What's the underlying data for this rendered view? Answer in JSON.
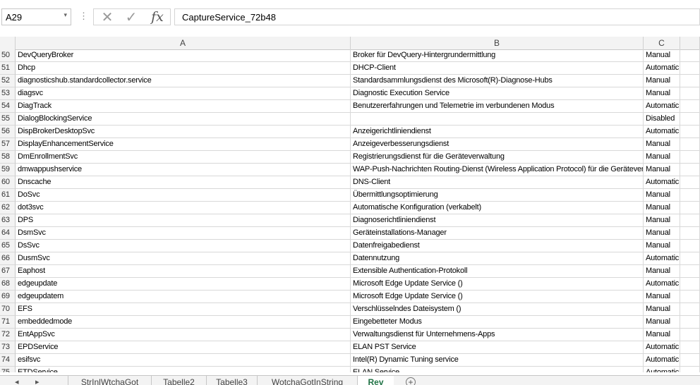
{
  "namebox": {
    "value": "A29",
    "arrow": "▾"
  },
  "formula_bar": {
    "value": "CaptureService_72b48",
    "dots": "⋮",
    "cancel": "✕",
    "enter": "✓",
    "fx": "fx"
  },
  "columns": [
    "A",
    "B",
    "C"
  ],
  "rows": [
    {
      "n": "50",
      "a": "DevQueryBroker",
      "b": "Broker für DevQuery-Hintergrundermittlung",
      "c": "Manual"
    },
    {
      "n": "51",
      "a": "Dhcp",
      "b": "DHCP-Client",
      "c": "Automatic"
    },
    {
      "n": "52",
      "a": "diagnosticshub.standardcollector.service",
      "b": "Standardsammlungsdienst des Microsoft(R)-Diagnose-Hubs",
      "c": "Manual"
    },
    {
      "n": "53",
      "a": "diagsvc",
      "b": "Diagnostic Execution Service",
      "c": "Manual"
    },
    {
      "n": "54",
      "a": "DiagTrack",
      "b": "Benutzererfahrungen und Telemetrie im verbundenen Modus",
      "c": "Automatic"
    },
    {
      "n": "55",
      "a": "DialogBlockingService",
      "b": "",
      "c": "Disabled"
    },
    {
      "n": "56",
      "a": "DispBrokerDesktopSvc",
      "b": "Anzeigerichtliniendienst",
      "c": "Automatic"
    },
    {
      "n": "57",
      "a": "DisplayEnhancementService",
      "b": "Anzeigeverbesserungsdienst",
      "c": "Manual"
    },
    {
      "n": "58",
      "a": "DmEnrollmentSvc",
      "b": "Registrierungsdienst für die Geräteverwaltung",
      "c": "Manual"
    },
    {
      "n": "59",
      "a": "dmwappushservice",
      "b": "WAP-Push-Nachrichten Routing-Dienst (Wireless Application Protocol) für die Geräteverwaltung",
      "c": "Manual"
    },
    {
      "n": "60",
      "a": "Dnscache",
      "b": "DNS-Client",
      "c": "Automatic"
    },
    {
      "n": "61",
      "a": "DoSvc",
      "b": "Übermittlungsoptimierung",
      "c": "Manual"
    },
    {
      "n": "62",
      "a": "dot3svc",
      "b": "Automatische Konfiguration (verkabelt)",
      "c": "Manual"
    },
    {
      "n": "63",
      "a": "DPS",
      "b": "Diagnoserichtliniendienst",
      "c": "Manual"
    },
    {
      "n": "64",
      "a": "DsmSvc",
      "b": "Geräteinstallations-Manager",
      "c": "Manual"
    },
    {
      "n": "65",
      "a": "DsSvc",
      "b": "Datenfreigabedienst",
      "c": "Manual"
    },
    {
      "n": "66",
      "a": "DusmSvc",
      "b": "Datennutzung",
      "c": "Automatic"
    },
    {
      "n": "67",
      "a": "Eaphost",
      "b": "Extensible Authentication-Protokoll",
      "c": "Manual"
    },
    {
      "n": "68",
      "a": "edgeupdate",
      "b": "Microsoft Edge Update Service ()",
      "c": "Automatic"
    },
    {
      "n": "69",
      "a": "edgeupdatem",
      "b": "Microsoft Edge Update Service ()",
      "c": "Manual"
    },
    {
      "n": "70",
      "a": "EFS",
      "b": "Verschlüsselndes Dateisystem ()",
      "c": "Manual"
    },
    {
      "n": "71",
      "a": "embeddedmode",
      "b": "Eingebetteter Modus",
      "c": "Manual"
    },
    {
      "n": "72",
      "a": "EntAppSvc",
      "b": "Verwaltungsdienst für Unternehmens-Apps",
      "c": "Manual"
    },
    {
      "n": "73",
      "a": "EPDService",
      "b": "ELAN PST Service",
      "c": "Automatic"
    },
    {
      "n": "74",
      "a": "esifsvc",
      "b": "Intel(R) Dynamic Tuning service",
      "c": "Automatic"
    },
    {
      "n": "75",
      "a": "ETDService",
      "b": "ELAN Service",
      "c": "Automatic"
    }
  ],
  "sheet_tabs": [
    {
      "label": "StrInlWtchaGot",
      "active": false
    },
    {
      "label": "Tabelle2",
      "active": false
    },
    {
      "label": "Tabelle3",
      "active": false
    },
    {
      "label": "WotchaGotInString",
      "active": false
    },
    {
      "label": "Rev",
      "active": true
    }
  ],
  "nav": {
    "prev": "◂",
    "next": "▸",
    "add": "+"
  },
  "colors": {
    "accent": "#217346",
    "gridline": "#d8d8d8",
    "header_bg": "#f3f3f3"
  }
}
